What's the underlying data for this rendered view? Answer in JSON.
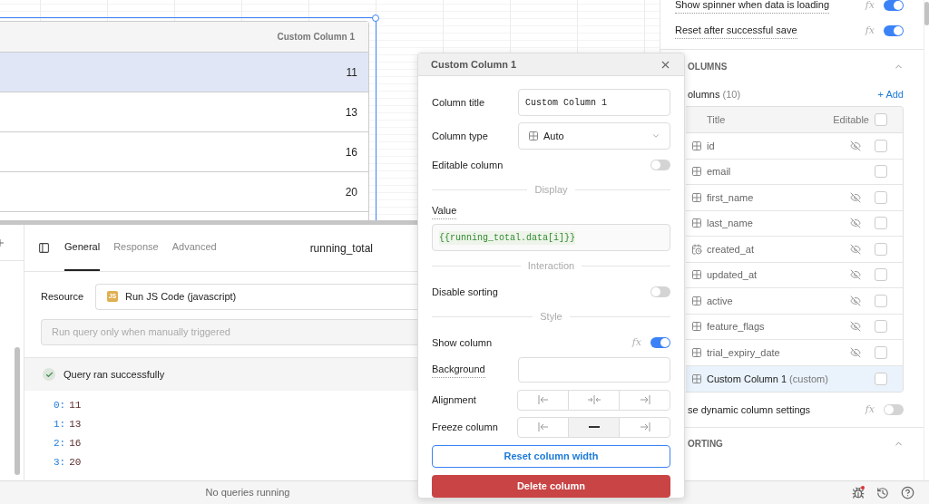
{
  "canvas": {
    "table": {
      "header": "Custom Column 1",
      "rows": [
        {
          "value": "11",
          "selected": true
        },
        {
          "value": "13",
          "selected": false
        },
        {
          "value": "16",
          "selected": false
        },
        {
          "value": "20",
          "selected": false
        }
      ]
    }
  },
  "query": {
    "tabs": [
      {
        "label": "General",
        "selected": true
      },
      {
        "label": "Response",
        "selected": false
      },
      {
        "label": "Advanced",
        "selected": false
      }
    ],
    "name": "running_total",
    "resource_label": "Resource",
    "resource_badge": "JS",
    "resource": "Run JS Code (javascript)",
    "trigger": "Run query only when manually triggered",
    "status": "Query ran successfully",
    "results": [
      {
        "index": "0:",
        "value": "11"
      },
      {
        "index": "1:",
        "value": "13"
      },
      {
        "index": "2:",
        "value": "16"
      },
      {
        "index": "3:",
        "value": "20"
      }
    ]
  },
  "inspector": {
    "toggles": [
      {
        "label": "Show spinner when data is loading",
        "fx": "fx",
        "on": true
      },
      {
        "label": "Reset after successful save",
        "fx": "fx",
        "on": true
      }
    ],
    "columns_section": "OLUMNS",
    "columns_label": "olumns",
    "columns_count": "(10)",
    "add": "+ Add",
    "table_headers": [
      "Title",
      "Editable"
    ],
    "editable_all": false,
    "columns": [
      {
        "name": "id",
        "kind": "grid",
        "hidden": true,
        "editable": false,
        "selected": false
      },
      {
        "name": "email",
        "kind": "grid",
        "hidden": false,
        "editable": false,
        "selected": false
      },
      {
        "name": "first_name",
        "kind": "grid",
        "hidden": true,
        "editable": false,
        "selected": false
      },
      {
        "name": "last_name",
        "kind": "grid",
        "hidden": true,
        "editable": false,
        "selected": false
      },
      {
        "name": "created_at",
        "kind": "date",
        "hidden": true,
        "editable": false,
        "selected": false
      },
      {
        "name": "updated_at",
        "kind": "grid",
        "hidden": true,
        "editable": false,
        "selected": false
      },
      {
        "name": "active",
        "kind": "grid",
        "hidden": true,
        "editable": false,
        "selected": false
      },
      {
        "name": "feature_flags",
        "kind": "grid",
        "hidden": true,
        "editable": false,
        "selected": false
      },
      {
        "name": "trial_expiry_date",
        "kind": "grid",
        "hidden": true,
        "editable": false,
        "selected": false
      },
      {
        "name": "Custom Column 1",
        "suffix": "(custom)",
        "kind": "grid",
        "hidden": false,
        "editable": false,
        "selected": true
      }
    ],
    "dynamic": {
      "label": "se dynamic column settings",
      "fx": "fx",
      "on": false
    },
    "sorting_section": "ORTING"
  },
  "popover": {
    "title": "Custom Column 1",
    "rows": [
      {
        "kind": "text",
        "label": "Column title",
        "value": "Custom Column 1"
      },
      {
        "kind": "select",
        "label": "Column type",
        "value": "Auto"
      },
      {
        "kind": "toggle",
        "label": "Editable column",
        "on": false
      },
      {
        "kind": "divider",
        "label": "Display"
      },
      {
        "kind": "code",
        "label": "Value",
        "value": "{{running_total.data[i]}}"
      },
      {
        "kind": "divider",
        "label": "Interaction"
      },
      {
        "kind": "toggle",
        "label": "Disable sorting",
        "on": false
      },
      {
        "kind": "divider",
        "label": "Style"
      },
      {
        "kind": "toggle",
        "label": "Show column",
        "fx": "fx",
        "on": true
      },
      {
        "kind": "empty",
        "label": "Background"
      },
      {
        "kind": "segmented",
        "label": "Alignment",
        "options": [
          {
            "kind": "left",
            "selected": false
          },
          {
            "kind": "center",
            "selected": false
          },
          {
            "kind": "right",
            "selected": false
          }
        ]
      },
      {
        "kind": "segmented",
        "label": "Freeze column",
        "options": [
          {
            "kind": "left",
            "selected": false
          },
          {
            "kind": "none",
            "selected": true
          },
          {
            "kind": "right",
            "selected": false
          }
        ]
      }
    ],
    "buttons": [
      {
        "kind": "outline",
        "label": "Reset column width"
      },
      {
        "kind": "danger",
        "label": "Delete column"
      }
    ]
  },
  "status_bar": {
    "text": "No queries running"
  }
}
